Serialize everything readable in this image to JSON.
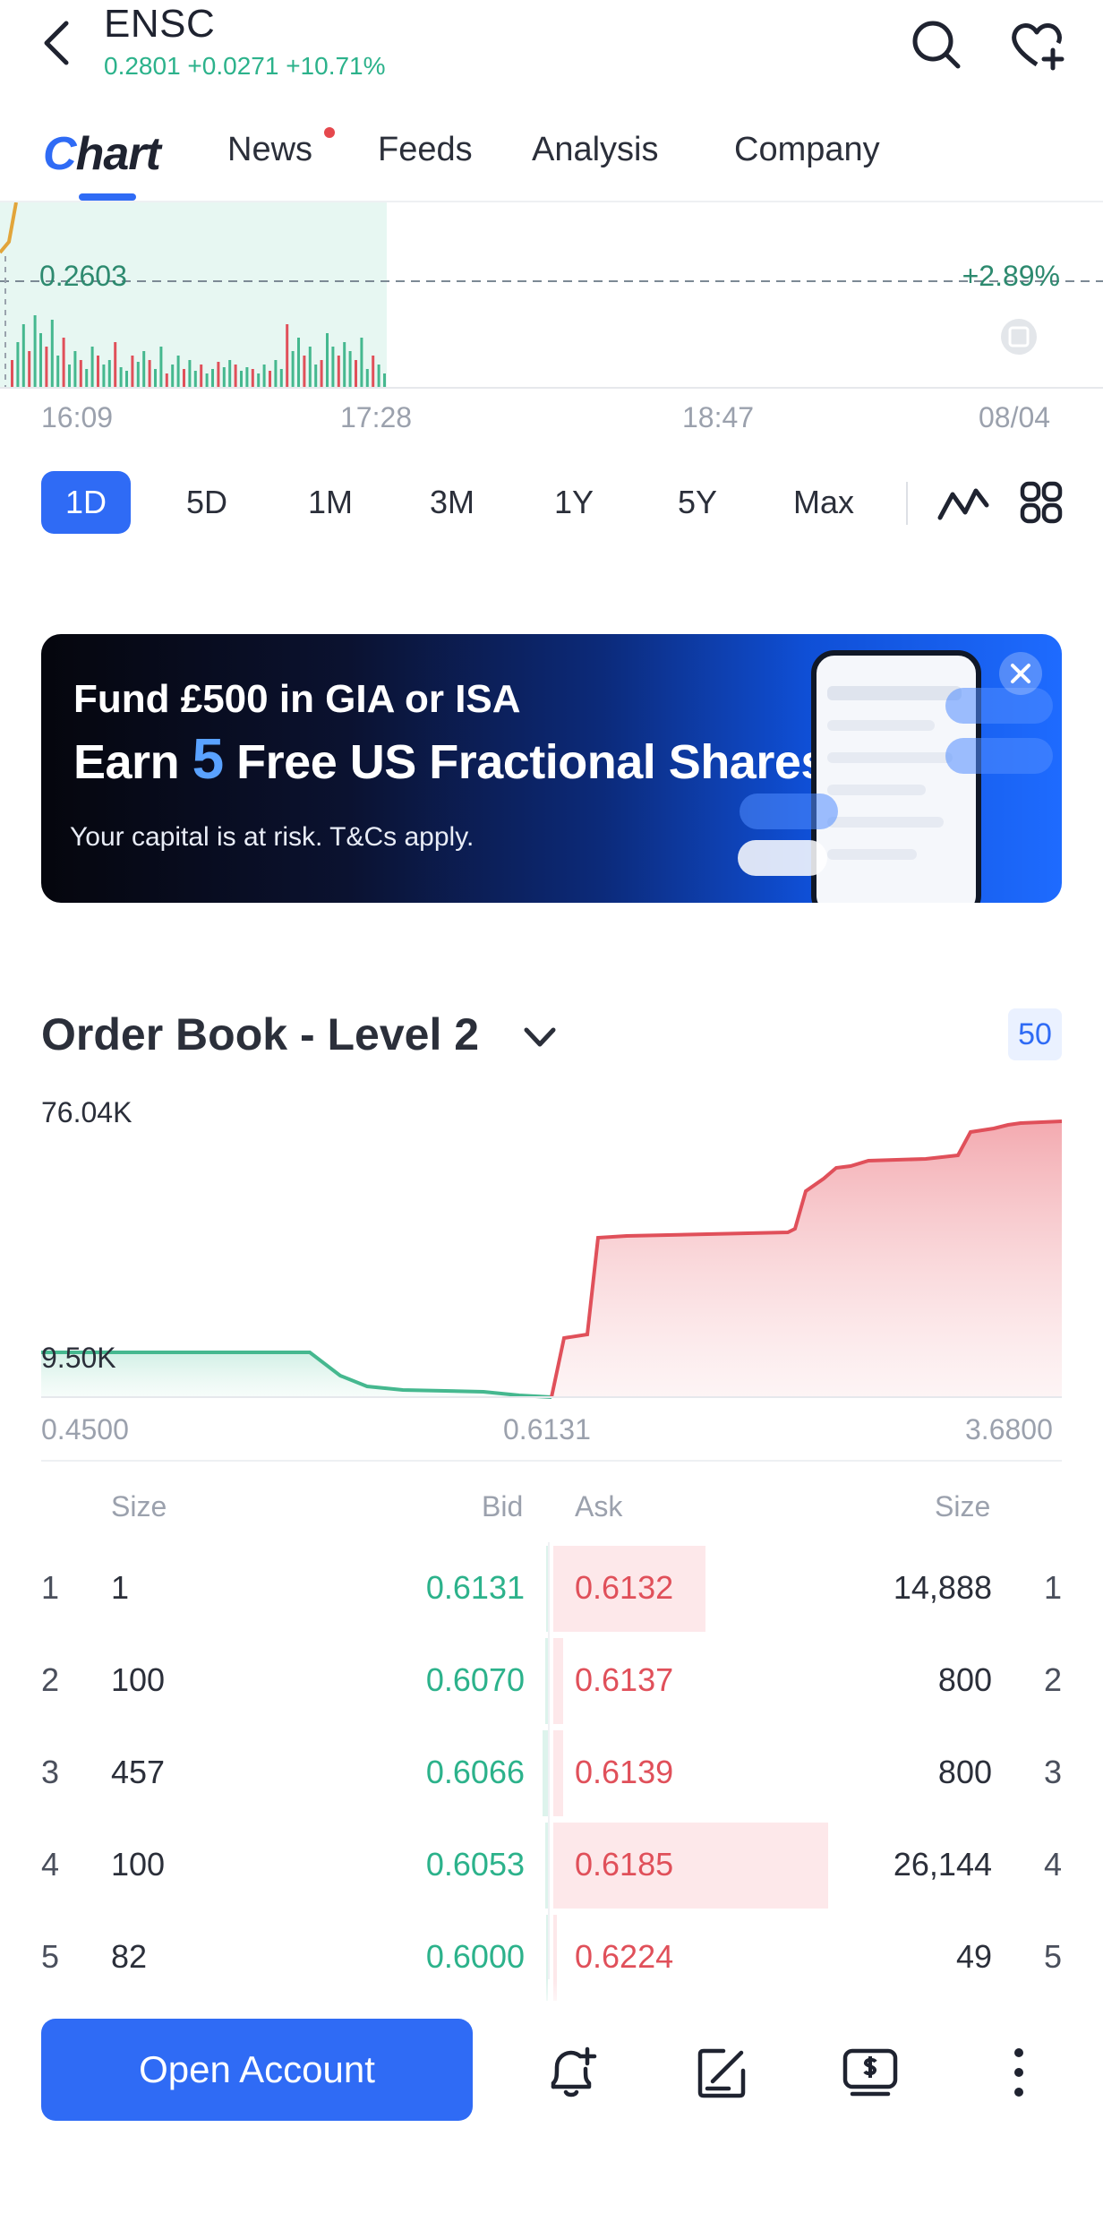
{
  "header": {
    "ticker": "ENSC",
    "quote": "0.2801 +0.0271 +10.71%",
    "icons": [
      "back-icon",
      "search-icon",
      "watchlist-add-icon"
    ]
  },
  "tabs": {
    "chart_logo": "Chart",
    "items": [
      "News",
      "Feeds",
      "Analysis",
      "Company"
    ],
    "active": "Chart"
  },
  "mini_chart": {
    "price_line": "0.2603",
    "pct": "+2.89%",
    "times": [
      "16:09",
      "17:28",
      "18:47",
      "08/04"
    ]
  },
  "periods": {
    "items": [
      "1D",
      "5D",
      "1M",
      "3M",
      "1Y",
      "5Y",
      "Max"
    ],
    "active": "1D",
    "icons": [
      "line-chart-icon",
      "grid-icon"
    ]
  },
  "banner": {
    "line1": "Fund £500 in GIA or ISA",
    "line2_pre": "Earn ",
    "line2_num": "5",
    "line2_post": " Free US Fractional Shares",
    "line3": "Your capital is at risk. T&Cs apply."
  },
  "order_book": {
    "title": "Order Book - Level 2",
    "depth": "50",
    "y_top": "76.04K",
    "y_bottom": "9.50K",
    "x_left": "0.4500",
    "x_mid": "0.6131",
    "x_right": "3.6800",
    "headers": {
      "bid_size": "Size",
      "bid": "Bid",
      "ask": "Ask",
      "ask_size": "Size"
    },
    "rows": [
      {
        "idx": "1",
        "bid_size": "1",
        "bid": "0.6131",
        "ask": "0.6132",
        "ask_size": "14,888",
        "ask_frac": 0.3,
        "bid_frac": 0.0
      },
      {
        "idx": "2",
        "bid_size": "100",
        "bid": "0.6070",
        "ask": "0.6137",
        "ask_size": "800",
        "ask_frac": 0.02,
        "bid_frac": 0.005
      },
      {
        "idx": "3",
        "bid_size": "457",
        "bid": "0.6066",
        "ask": "0.6139",
        "ask_size": "800",
        "ask_frac": 0.02,
        "bid_frac": 0.01
      },
      {
        "idx": "4",
        "bid_size": "100",
        "bid": "0.6053",
        "ask": "0.6185",
        "ask_size": "26,144",
        "ask_frac": 0.54,
        "bid_frac": 0.005
      },
      {
        "idx": "5",
        "bid_size": "82",
        "bid": "0.6000",
        "ask": "0.6224",
        "ask_size": "49",
        "ask_frac": 0.005,
        "bid_frac": 0.003
      }
    ]
  },
  "bottom_bar": {
    "open_account": "Open Account",
    "icons": [
      "alert-add-icon",
      "note-edit-icon",
      "trade-icon",
      "more-icon"
    ]
  },
  "colors": {
    "accent": "#2f6bf5",
    "up": "#2cb28b",
    "down": "#e0505a"
  }
}
